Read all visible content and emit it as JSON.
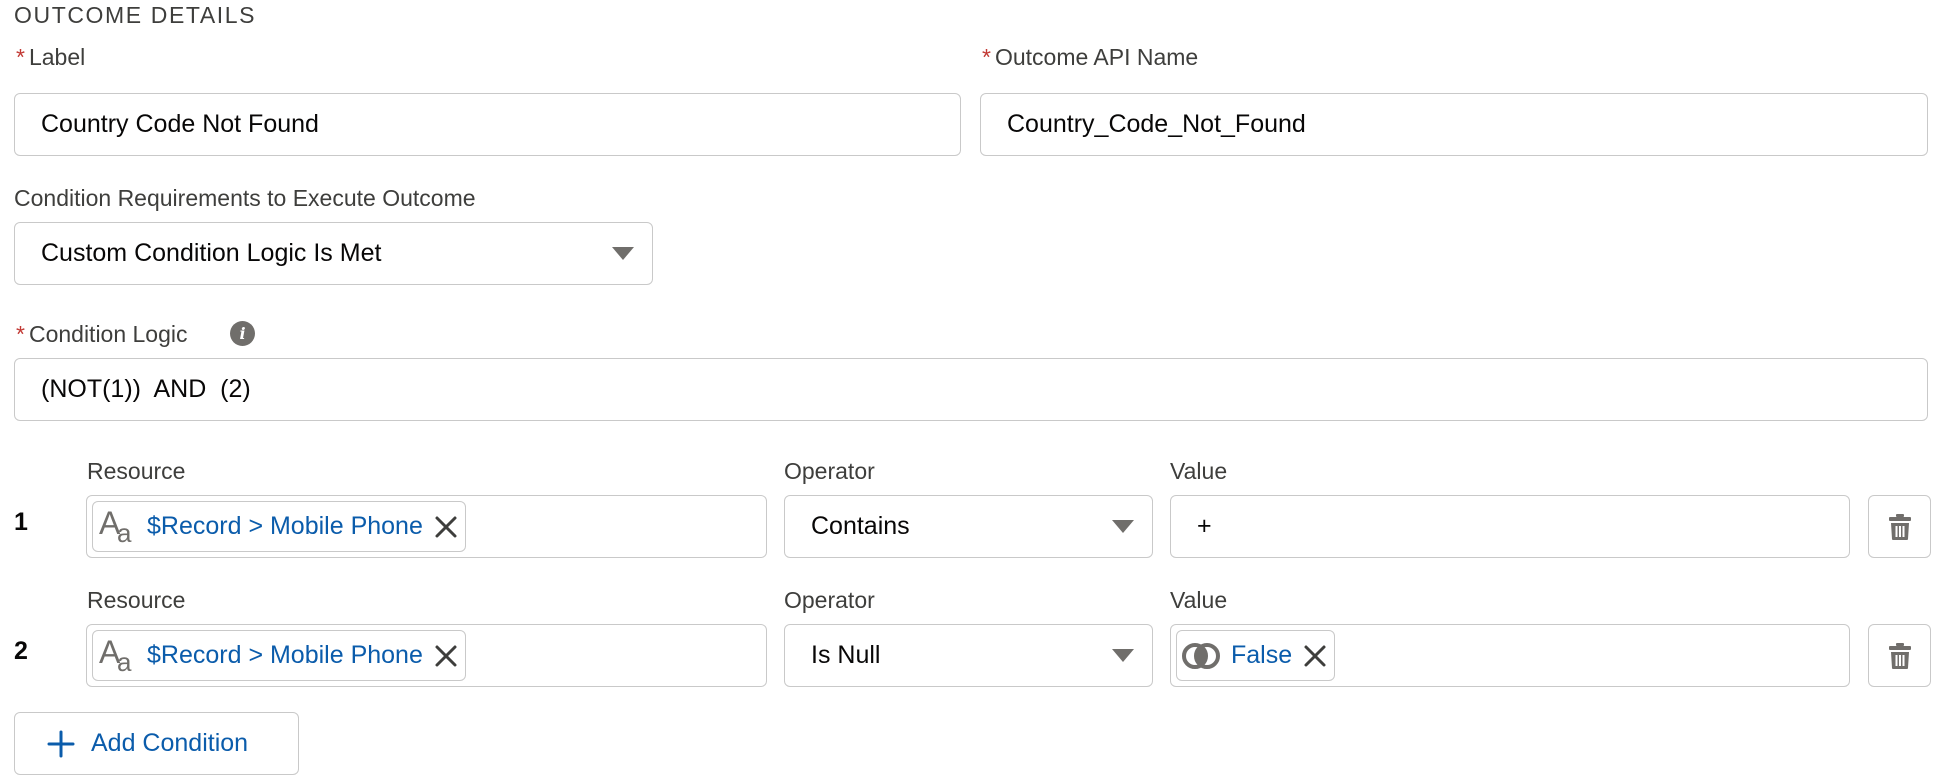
{
  "section": {
    "title": "OUTCOME DETAILS"
  },
  "required_mark": "*",
  "label_field": {
    "label": "Label",
    "value": "Country Code Not Found"
  },
  "api_name_field": {
    "label": "Outcome API Name",
    "value": "Country_Code_Not_Found"
  },
  "condition_requirements": {
    "label": "Condition Requirements to Execute Outcome",
    "selected": "Custom Condition Logic Is Met"
  },
  "condition_logic": {
    "label": "Condition Logic",
    "info_icon": "info-icon",
    "value": "(NOT(1))  AND  (2)"
  },
  "conditions": [
    {
      "number": "1",
      "resource_label": "Resource",
      "resource_value": "$Record > Mobile Phone",
      "resource_icon": "text-type-icon",
      "operator_label": "Operator",
      "operator": "Contains",
      "value_label": "Value",
      "value": "+"
    },
    {
      "number": "2",
      "resource_label": "Resource",
      "resource_value": "$Record > Mobile Phone",
      "resource_icon": "text-type-icon",
      "operator_label": "Operator",
      "operator": "Is Null",
      "value_label": "Value",
      "value": "False",
      "value_icon": "boolean-icon"
    }
  ],
  "add_condition": {
    "label": "Add Condition",
    "icon": "plus-icon"
  },
  "colors": {
    "required": "#c23934",
    "link": "#0b5cab",
    "border": "#c9c9c9",
    "icon": "#706e6b"
  }
}
